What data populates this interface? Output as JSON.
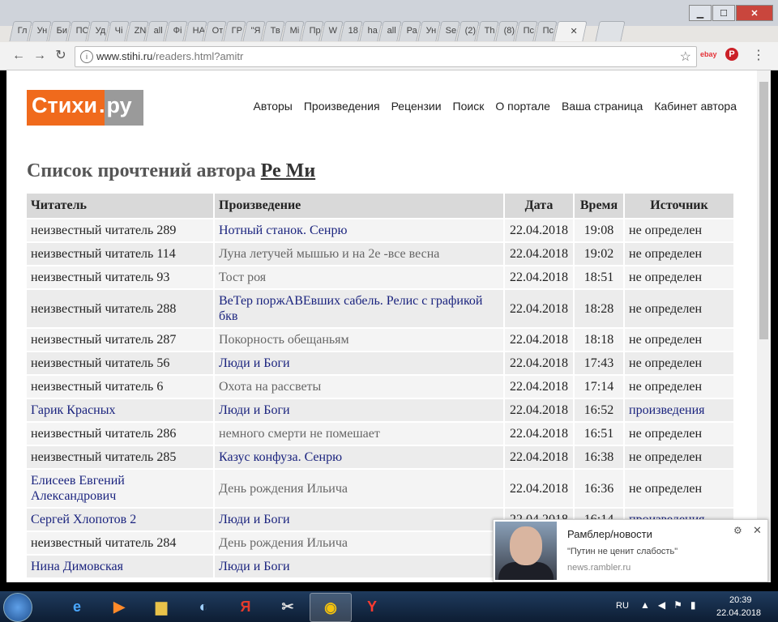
{
  "browser": {
    "tabs": [
      "Гл",
      "Ун",
      "Би",
      "ПС",
      "Уд",
      "Чі",
      "ZN",
      "all",
      "Фі",
      "НА",
      "От",
      "ГР",
      "\"Я",
      "Тв",
      "Мі",
      "Пр",
      "W",
      "18",
      "ha",
      "all",
      "Ра",
      "Ун",
      "Se",
      "(2)",
      "Th",
      "(8)",
      "Пс",
      "Пс",
      ""
    ],
    "url_host": "www.stihi.ru",
    "url_path": "/readers.html?amitr",
    "ext_ebay": "ebay",
    "ext_pin": "P"
  },
  "site": {
    "logo_main": "Стихи",
    "logo_dot": ".",
    "logo_ru": "ру",
    "nav": [
      "Авторы",
      "Произведения",
      "Рецензии",
      "Поиск",
      "О портале",
      "Ваша страница",
      "Кабинет автора"
    ]
  },
  "page": {
    "title_prefix": "Список прочтений автора ",
    "author": "Ре Ми"
  },
  "table": {
    "headers": [
      "Читатель",
      "Произведение",
      "Дата",
      "Время",
      "Источник"
    ],
    "rows": [
      {
        "reader": "неизвестный читатель 289",
        "work": "Нотный станок. Сенрю",
        "date": "22.04.2018",
        "time": "19:08",
        "source": "не определен"
      },
      {
        "reader": "неизвестный читатель 114",
        "work": "Луна летучей мышью и на 2е -все весна",
        "date": "22.04.2018",
        "time": "19:02",
        "source": "не определен"
      },
      {
        "reader": "неизвестный читатель 93",
        "work": "Тост роя",
        "date": "22.04.2018",
        "time": "18:51",
        "source": "не определен"
      },
      {
        "reader": "неизвестный читатель 288",
        "work": "ВеТер поржАВЕвших сабель. Релис с графикой бкв",
        "date": "22.04.2018",
        "time": "18:28",
        "source": "не определен"
      },
      {
        "reader": "неизвестный читатель 287",
        "work": "Покорность обещаньям",
        "date": "22.04.2018",
        "time": "18:18",
        "source": "не определен"
      },
      {
        "reader": "неизвестный читатель 56",
        "work": "Люди и Боги",
        "date": "22.04.2018",
        "time": "17:43",
        "source": "не определен"
      },
      {
        "reader": "неизвестный читатель 6",
        "work": "Охота на рассветы",
        "date": "22.04.2018",
        "time": "17:14",
        "source": "не определен"
      },
      {
        "reader": "Гарик Красных",
        "work": "Люди и Боги",
        "date": "22.04.2018",
        "time": "16:52",
        "source": "произведения"
      },
      {
        "reader": "неизвестный читатель 286",
        "work": "немного смерти не помешает",
        "date": "22.04.2018",
        "time": "16:51",
        "source": "не определен"
      },
      {
        "reader": "неизвестный читатель 285",
        "work": "Казус конфуза. Сенрю",
        "date": "22.04.2018",
        "time": "16:38",
        "source": "не определен"
      },
      {
        "reader": "Елисеев Евгений Александрович",
        "work": "День рождения Ильича",
        "date": "22.04.2018",
        "time": "16:36",
        "source": "не определен"
      },
      {
        "reader": "Сергей Хлопотов 2",
        "work": "Люди и Боги",
        "date": "22.04.2018",
        "time": "16:14",
        "source": "произведения"
      },
      {
        "reader": "неизвестный читатель 284",
        "work": "День рождения Ильича",
        "date": "",
        "time": "",
        "source": ""
      },
      {
        "reader": "Нина Димовская",
        "work": "Люди и Боги",
        "date": "",
        "time": "",
        "source": ""
      }
    ]
  },
  "notification": {
    "title": "Рамблер/новости",
    "body": "\"Путин не ценит слабость\"",
    "source": "news.rambler.ru"
  },
  "taskbar": {
    "lang": "RU",
    "time": "20:39",
    "date": "22.04.2018"
  }
}
